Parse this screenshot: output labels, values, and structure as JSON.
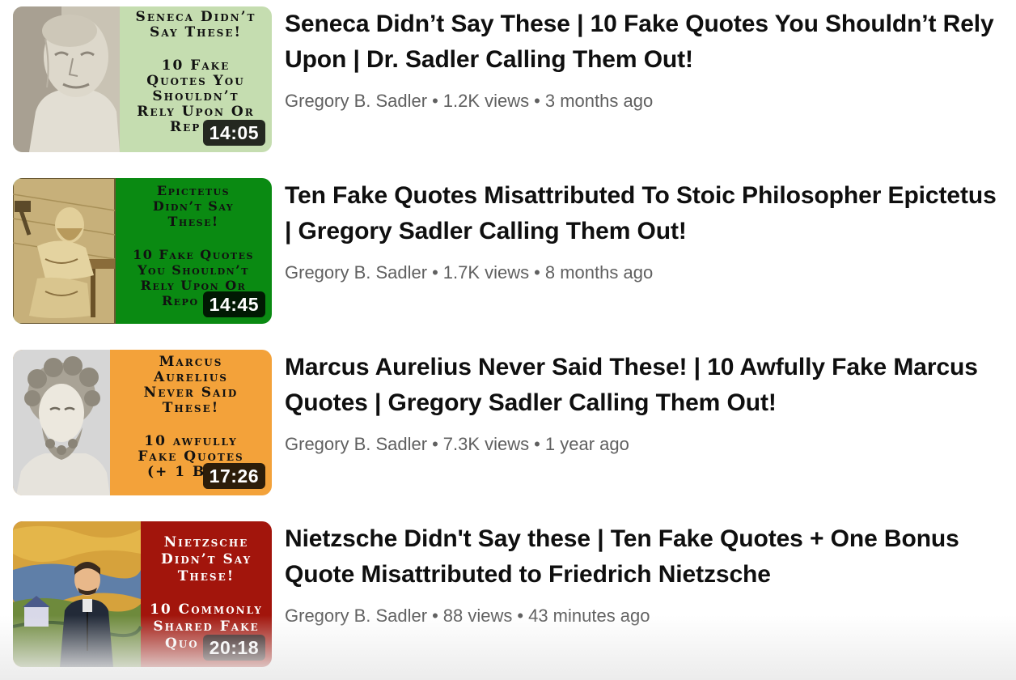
{
  "videos": [
    {
      "title_lines": [
        "Seneca Didn’t Say These | 10 Fake Quotes You Shouldn’t Rely",
        "Upon | Dr. Sadler Calling Them Out!"
      ],
      "channel": "Gregory B. Sadler",
      "views": "1.2K views",
      "age": "3 months ago",
      "duration": "14:05",
      "thumb_text": [
        "Seneca Didn’t",
        "Say These!",
        "",
        "10 Fake",
        "Quotes You",
        "Shouldn’t",
        "Rely Upon Or",
        "Rep"
      ],
      "thumb_bg": "#c5ddb0",
      "thumb_fg": "#111111"
    },
    {
      "title_lines": [
        "Ten Fake Quotes Misattributed To Stoic Philosopher Epictetus",
        "| Gregory Sadler Calling Them Out!"
      ],
      "channel": "Gregory B. Sadler",
      "views": "1.7K views",
      "age": "8 months ago",
      "duration": "14:45",
      "thumb_text": [
        "Epictetus",
        "Didn’t Say",
        "These!",
        "",
        "10 Fake Quotes",
        "You Shouldn’t",
        "Rely Upon Or",
        "Repo"
      ],
      "thumb_bg": "#0a8a12",
      "thumb_fg": "#111111"
    },
    {
      "title_lines": [
        "Marcus Aurelius Never Said These! | 10 Awfully Fake Marcus",
        "Quotes | Gregory Sadler Calling Them Out!"
      ],
      "channel": "Gregory B. Sadler",
      "views": "7.3K views",
      "age": "1 year ago",
      "duration": "17:26",
      "thumb_text": [
        "Marcus",
        "Aurelius",
        "Never Said",
        "These!",
        "",
        "10 awfully",
        "Fake Quotes",
        "(+ 1 B"
      ],
      "thumb_bg": "#f3a23a",
      "thumb_fg": "#111111"
    },
    {
      "title_lines": [
        "Nietzsche Didn't Say these | Ten Fake Quotes + One Bonus",
        "Quote Misattributed to Friedrich Nietzsche"
      ],
      "channel": "Gregory B. Sadler",
      "views": "88 views",
      "age": "43 minutes ago",
      "duration": "20:18",
      "thumb_text": [
        "Nietzsche",
        "Didn’t Say",
        "These!",
        "",
        "10 Commonly",
        "Shared Fake",
        "Quo"
      ],
      "thumb_bg": "#a2150c",
      "thumb_fg": "#ffffff"
    }
  ],
  "separator": "•",
  "icons": [
    "seneca-bust-image",
    "epictetus-engraving-image",
    "marcus-aurelius-bust-image",
    "nietzsche-painting-image"
  ]
}
